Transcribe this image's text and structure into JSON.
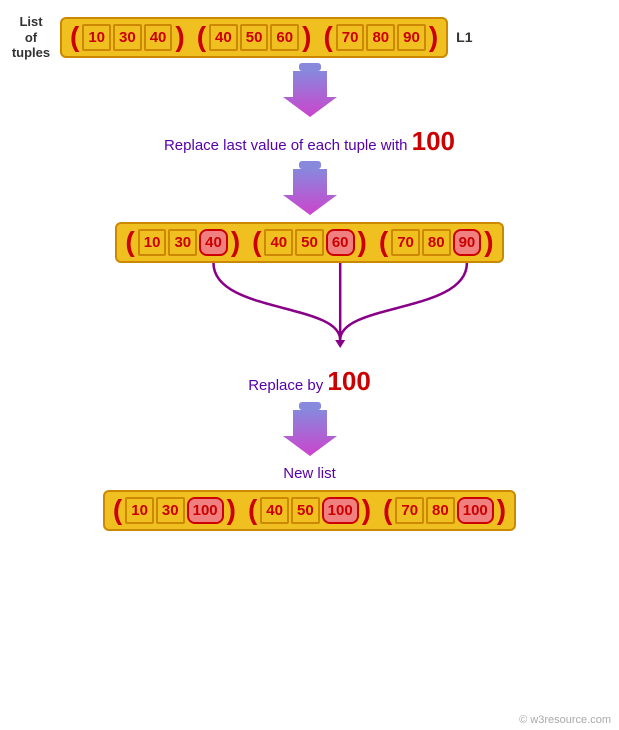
{
  "title": "List of tuples diagram",
  "label_list_of_tuples": "List\nof\ntuples",
  "l1_label": "L1",
  "tuples_original": [
    {
      "values": [
        "10",
        "30",
        "40"
      ]
    },
    {
      "values": [
        "40",
        "50",
        "60"
      ]
    },
    {
      "values": [
        "70",
        "80",
        "90"
      ]
    }
  ],
  "step1_text": "Replace last value of each tuple with",
  "replace_value": "100",
  "tuples_middle": [
    {
      "values": [
        "10",
        "30",
        "40"
      ],
      "highlight_last": true
    },
    {
      "values": [
        "40",
        "50",
        "60"
      ],
      "highlight_last": true
    },
    {
      "values": [
        "70",
        "80",
        "90"
      ],
      "highlight_last": true
    }
  ],
  "replace_by_text": "Replace by",
  "replace_by_value": "100",
  "new_list_label": "New list",
  "tuples_result": [
    {
      "values": [
        "10",
        "30",
        "100"
      ],
      "highlight_last": true
    },
    {
      "values": [
        "40",
        "50",
        "100"
      ],
      "highlight_last": true
    },
    {
      "values": [
        "70",
        "80",
        "100"
      ],
      "highlight_last": true
    }
  ],
  "watermark": "© w3resource.com"
}
